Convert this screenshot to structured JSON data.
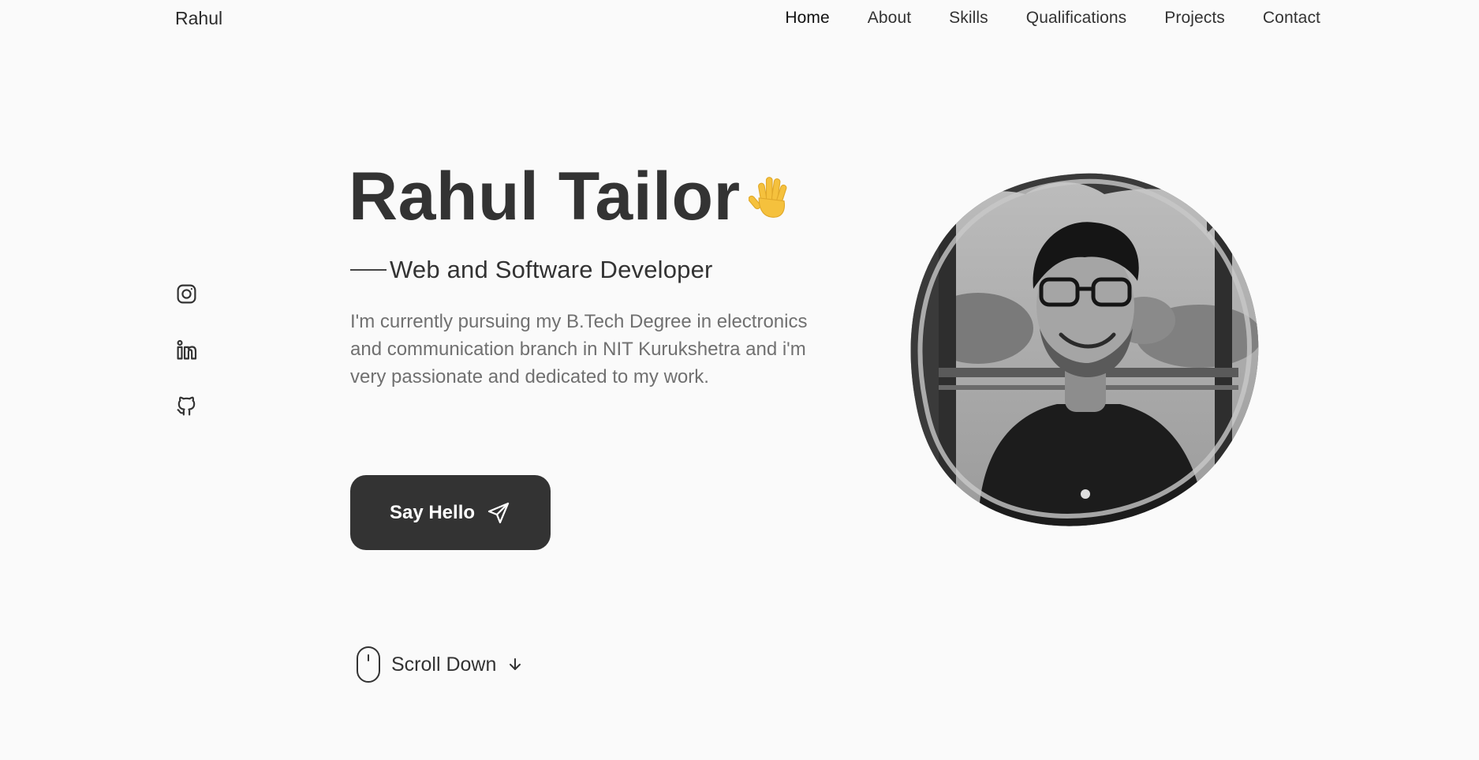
{
  "header": {
    "logo": "Rahul",
    "nav": [
      {
        "label": "Home",
        "active": true
      },
      {
        "label": "About",
        "active": false
      },
      {
        "label": "Skills",
        "active": false
      },
      {
        "label": "Qualifications",
        "active": false
      },
      {
        "label": "Projects",
        "active": false
      },
      {
        "label": "Contact",
        "active": false
      }
    ]
  },
  "social": [
    {
      "icon": "instagram-icon"
    },
    {
      "icon": "linkedin-icon"
    },
    {
      "icon": "github-icon"
    }
  ],
  "hero": {
    "name": "Rahul Tailor",
    "wave_icon": "waving-hand-icon",
    "subtitle": "Web and Software Developer",
    "description": "I'm currently pursuing my B.Tech Degree in electronics and communication branch in NIT Kurukshetra and i'm very passionate and dedicated to my work.",
    "cta_label": "Say Hello",
    "cta_icon": "send-icon",
    "scroll_label": "Scroll Down",
    "scroll_icon": "mouse-icon",
    "scroll_arrow_icon": "arrow-down-icon"
  },
  "profile": {
    "image": "profile-photo",
    "style": "grayscale"
  },
  "colors": {
    "background": "#fafafa",
    "text": "#333333",
    "muted": "#707070",
    "button": "#333333",
    "wave": "#f5c13d"
  }
}
